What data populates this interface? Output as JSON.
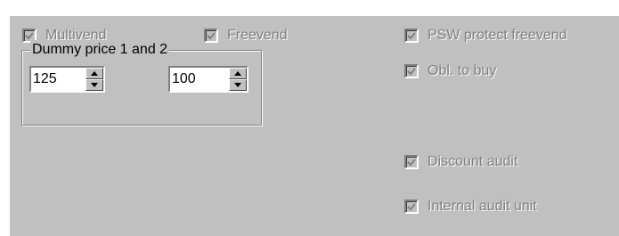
{
  "colors": {
    "panel": "#c0c0c0",
    "disabled_text": "#808080",
    "field_bg": "#ffffff"
  },
  "checkboxes": {
    "multivend": {
      "label": "Multivend",
      "checked": true,
      "enabled": false
    },
    "freevend": {
      "label": "Freevend",
      "checked": true,
      "enabled": false
    },
    "psw_protect_freevend": {
      "label": "PSW protect freevend",
      "checked": true,
      "enabled": false
    },
    "obl_to_buy": {
      "label": "Obl. to buy",
      "checked": true,
      "enabled": false
    },
    "discount_audit": {
      "label": "Discount audit",
      "checked": true,
      "enabled": false
    },
    "internal_audit_unit": {
      "label": "Internal audit unit",
      "checked": true,
      "enabled": false
    }
  },
  "dummy_price_group": {
    "legend": "Dummy price 1 and 2",
    "price1": "125",
    "price2": "100"
  },
  "icons": {
    "check": "check-icon",
    "spin_up": "arrow-up-icon",
    "spin_down": "arrow-down-icon"
  }
}
